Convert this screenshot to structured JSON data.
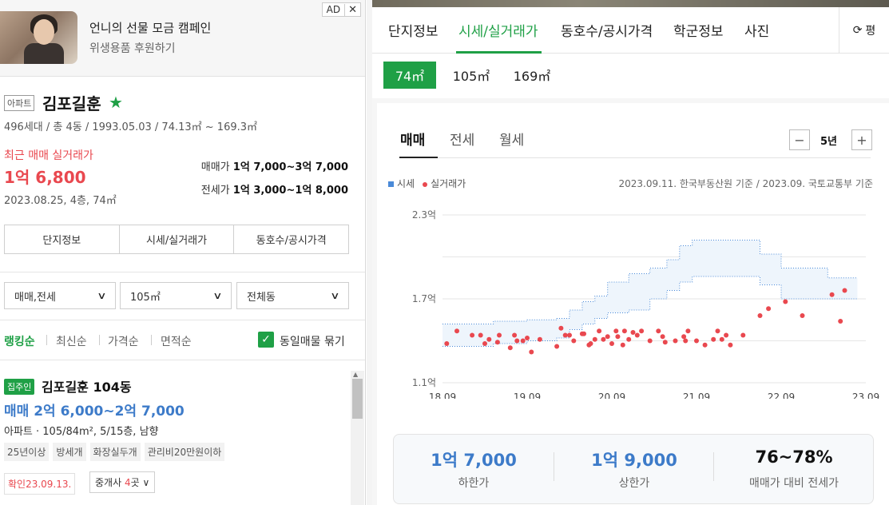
{
  "ad": {
    "title": "언니의 선물 모금 캠페인",
    "subtitle": "위생용품 후원하기",
    "badge": "AD",
    "close": "✕"
  },
  "summary": {
    "type_tag": "아파트",
    "name": "김포길훈",
    "info": "496세대 / 총 4동 / 1993.05.03 / 74.13㎡ ~ 169.3㎡",
    "recent_label": "최근 매매 실거래가",
    "recent_price": "1억 6,800",
    "recent_date": "2023.08.25, 4층, 74㎡",
    "sale_label": "매매가",
    "sale_range": "1억 7,000~3억 7,000",
    "jeonse_label": "전세가",
    "jeonse_range": "1억 3,000~1억 8,000"
  },
  "left_tabs": [
    "단지정보",
    "시세/실거래가",
    "동호수/공시가격"
  ],
  "filters": {
    "trade": "매매,전세",
    "area": "105㎡",
    "dong": "전체동"
  },
  "sort": {
    "items": [
      "랭킹순",
      "최신순",
      "가격순",
      "면적순"
    ],
    "group_label": "동일매물 묶기"
  },
  "listing": {
    "owner_tag": "집주인",
    "title": "김포길훈 104동",
    "price": "매매 2억 6,000~2억 7,000",
    "spec": "아파트 · 105/84m², 5/15층, 남향",
    "tags": [
      "25년이상",
      "방세개",
      "화장실두개",
      "관리비20만원이하"
    ],
    "confirm": "확인23.09.13.",
    "agent_prefix": "중개사 ",
    "agent_count": "4",
    "agent_suffix": "곳"
  },
  "top_tabs": [
    "단지정보",
    "시세/실거래가",
    "동호수/공시가격",
    "학군정보",
    "사진"
  ],
  "pyeong_label": "평",
  "area_tabs": [
    "74㎡",
    "105㎡",
    "169㎡"
  ],
  "chart_tabs": [
    "매매",
    "전세",
    "월세"
  ],
  "period": "5년",
  "legend": {
    "market": "시세",
    "actual": "실거래가"
  },
  "source_note": "2023.09.11. 한국부동산원 기준 / 2023.09. 국토교통부 기준",
  "colors": {
    "brand_green": "#1fa046",
    "price_blue": "#3d7bc9",
    "accent_red": "#e9484f",
    "band_fill": "#eef5fc",
    "band_line": "#4a8ad8"
  },
  "chart_data": {
    "type": "scatter",
    "title": "",
    "xlabel": "",
    "ylabel": "",
    "x_ticks": [
      "18.09",
      "19.09",
      "20.09",
      "21.09",
      "22.09",
      "23.09"
    ],
    "y_ticks": [
      "1.1억",
      "1.7억",
      "2.3억"
    ],
    "xlim": [
      2018.75,
      2023.75
    ],
    "ylim": [
      1.1,
      2.3
    ],
    "grid": true,
    "series": [
      {
        "name": "시세",
        "kind": "band",
        "x": [
          2018.75,
          2019.2,
          2019.35,
          2019.6,
          2019.75,
          2020.0,
          2020.1,
          2020.25,
          2020.4,
          2020.55,
          2020.7,
          2020.95,
          2021.2,
          2021.4,
          2021.55,
          2021.7,
          2022.0,
          2022.25,
          2022.5,
          2022.75,
          2023.0,
          2023.3,
          2023.55,
          2023.65
        ],
        "upper": [
          1.52,
          1.52,
          1.54,
          1.54,
          1.55,
          1.55,
          1.56,
          1.62,
          1.68,
          1.72,
          1.82,
          1.88,
          1.92,
          1.98,
          2.08,
          2.12,
          2.12,
          2.12,
          2.02,
          1.92,
          1.92,
          1.85,
          1.85,
          1.85
        ],
        "lower": [
          1.36,
          1.36,
          1.38,
          1.38,
          1.4,
          1.4,
          1.42,
          1.48,
          1.52,
          1.56,
          1.6,
          1.62,
          1.7,
          1.76,
          1.82,
          1.86,
          1.86,
          1.86,
          1.8,
          1.7,
          1.7,
          1.7,
          1.7,
          1.7
        ]
      },
      {
        "name": "실거래가",
        "kind": "points",
        "x": [
          2018.8,
          2018.92,
          2019.1,
          2019.2,
          2019.25,
          2019.3,
          2019.4,
          2019.42,
          2019.55,
          2019.6,
          2019.63,
          2019.7,
          2019.75,
          2019.8,
          2019.9,
          2020.1,
          2020.15,
          2020.2,
          2020.25,
          2020.3,
          2020.4,
          2020.42,
          2020.48,
          2020.5,
          2020.55,
          2020.6,
          2020.65,
          2020.7,
          2020.75,
          2020.8,
          2020.82,
          2020.88,
          2020.9,
          2020.95,
          2021.0,
          2021.05,
          2021.1,
          2021.2,
          2021.3,
          2021.35,
          2021.38,
          2021.5,
          2021.6,
          2021.62,
          2021.65,
          2021.75,
          2021.85,
          2021.95,
          2022.0,
          2022.05,
          2022.1,
          2022.15,
          2022.3,
          2022.5,
          2022.6,
          2022.8,
          2023.0,
          2023.35,
          2023.45,
          2023.5
        ],
        "y": [
          1.38,
          1.47,
          1.44,
          1.44,
          1.38,
          1.41,
          1.39,
          1.44,
          1.35,
          1.44,
          1.4,
          1.4,
          1.42,
          1.32,
          1.41,
          1.36,
          1.49,
          1.44,
          1.44,
          1.4,
          1.45,
          1.45,
          1.37,
          1.38,
          1.41,
          1.47,
          1.41,
          1.43,
          1.38,
          1.47,
          1.43,
          1.37,
          1.47,
          1.41,
          1.46,
          1.44,
          1.47,
          1.4,
          1.47,
          1.43,
          1.39,
          1.4,
          1.43,
          1.4,
          1.47,
          1.4,
          1.37,
          1.41,
          1.47,
          1.41,
          1.44,
          1.37,
          1.44,
          1.58,
          1.63,
          1.68,
          1.58,
          1.73,
          1.54,
          1.76
        ]
      }
    ]
  },
  "stats": [
    {
      "value": "1억 7,000",
      "label": "하한가",
      "color": "#3d7bc9"
    },
    {
      "value": "1억 9,000",
      "label": "상한가",
      "color": "#3d7bc9"
    },
    {
      "value": "76~78%",
      "label": "매매가 대비 전세가",
      "color": "#111111"
    }
  ]
}
